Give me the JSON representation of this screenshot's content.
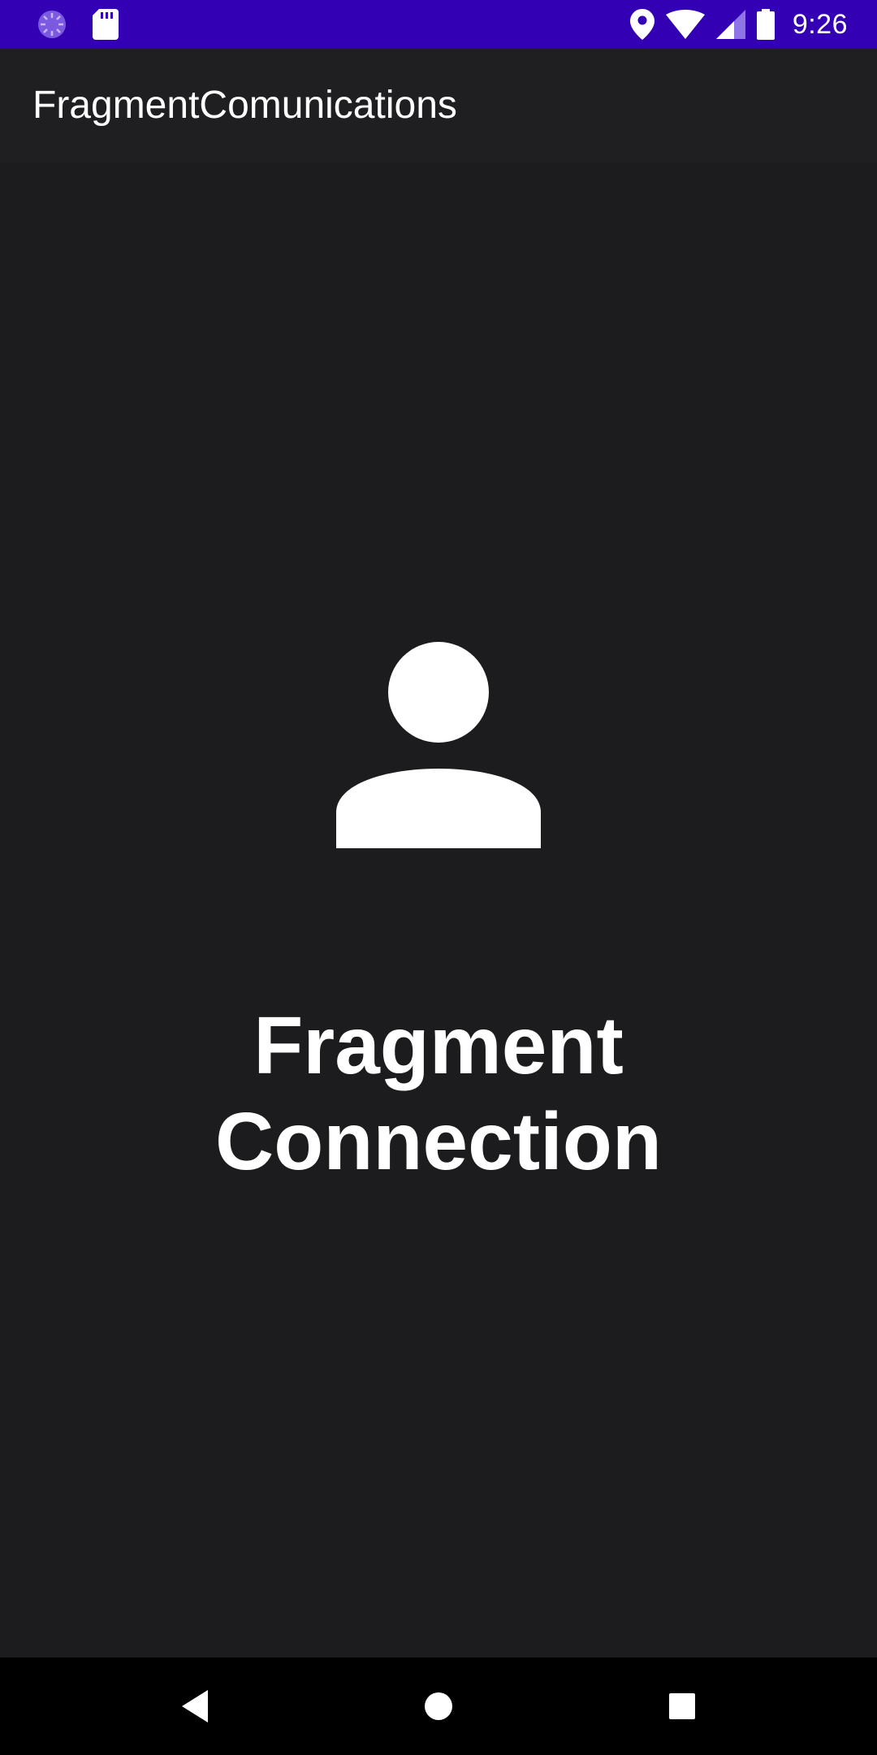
{
  "status_bar": {
    "background": "#3300b3",
    "left_icons": [
      "loading-spinner-icon",
      "sd-card-icon"
    ],
    "right_icons": [
      "location-pin-icon",
      "wifi-icon",
      "cellular-signal-icon",
      "battery-icon"
    ],
    "time": "9:26"
  },
  "app_bar": {
    "title": "FragmentComunications"
  },
  "main": {
    "icon": "person-icon",
    "heading_line1": "Fragment",
    "heading_line2": "Connection"
  },
  "nav_bar": {
    "buttons": [
      "back-icon",
      "home-icon",
      "recents-icon"
    ]
  },
  "colors": {
    "status_bar": "#3300b3",
    "app_bar": "#1f1f21",
    "background": "#1c1c1e",
    "nav_bar": "#000000",
    "foreground": "#ffffff"
  }
}
